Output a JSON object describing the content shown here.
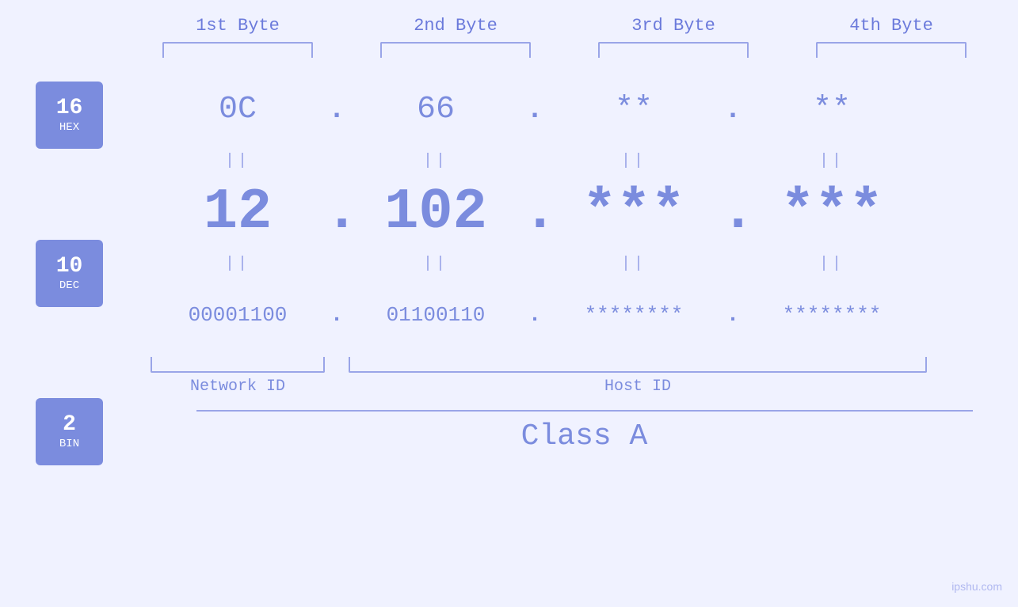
{
  "columns": {
    "headers": [
      "1st Byte",
      "2nd Byte",
      "3rd Byte",
      "4th Byte"
    ]
  },
  "bases": [
    {
      "num": "16",
      "base": "HEX"
    },
    {
      "num": "10",
      "base": "DEC"
    },
    {
      "num": "2",
      "base": "BIN"
    }
  ],
  "rows": {
    "hex": {
      "values": [
        "0C",
        "66",
        "**",
        "**"
      ],
      "dots": [
        ".",
        ".",
        ".",
        ""
      ]
    },
    "dec": {
      "values": [
        "12",
        "102",
        "***",
        "***"
      ],
      "dots": [
        ".",
        ".",
        ".",
        ""
      ]
    },
    "bin": {
      "values": [
        "00001100",
        "01100110",
        "********",
        "********"
      ],
      "dots": [
        ".",
        ".",
        ".",
        ""
      ]
    }
  },
  "separators": {
    "hex_to_dec": [
      "||",
      "||",
      "||",
      "||"
    ],
    "dec_to_bin": [
      "||",
      "||",
      "||",
      "||"
    ]
  },
  "labels": {
    "network_id": "Network ID",
    "host_id": "Host ID",
    "class": "Class A"
  },
  "watermark": "ipshu.com"
}
